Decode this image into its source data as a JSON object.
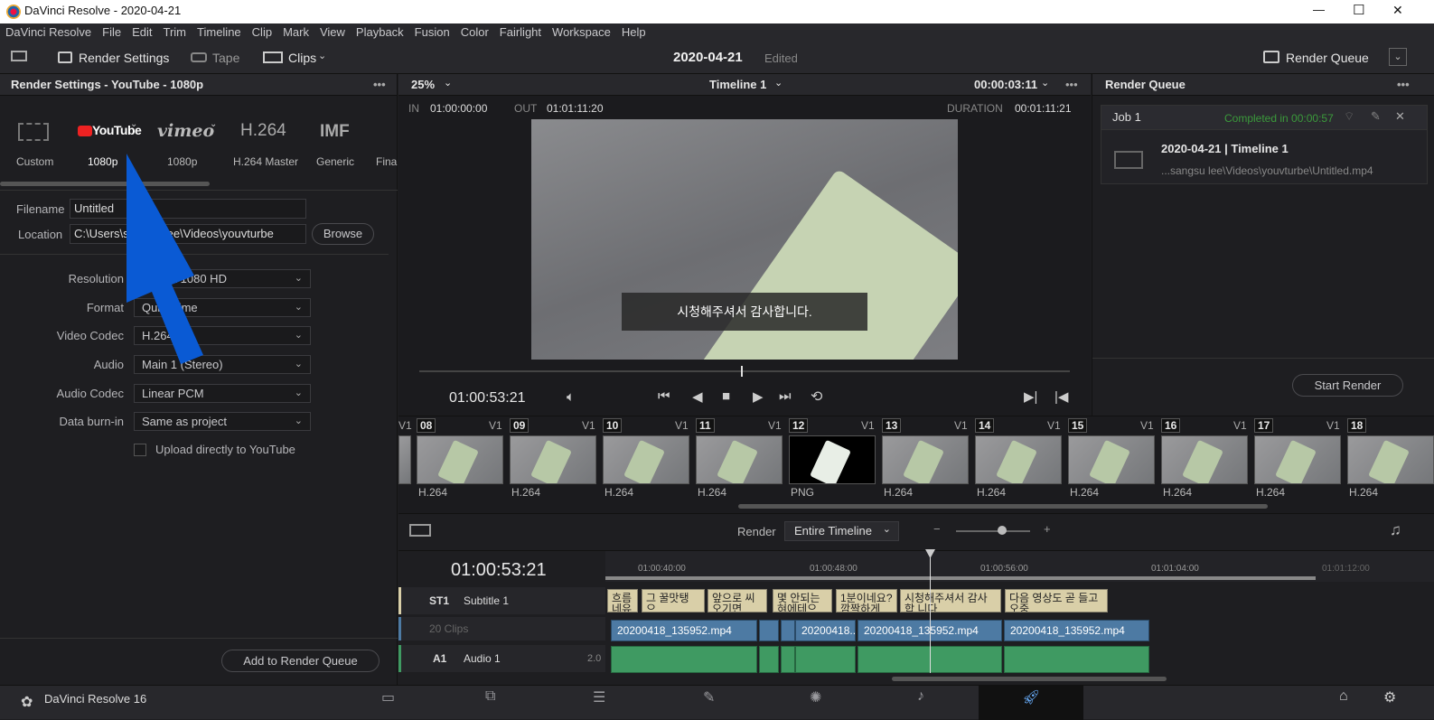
{
  "window": {
    "title": "DaVinci Resolve - 2020-04-21",
    "minimize": "—",
    "maximize": "☐",
    "close": "✕"
  },
  "menu": [
    "DaVinci Resolve",
    "File",
    "Edit",
    "Trim",
    "Timeline",
    "Clip",
    "Mark",
    "View",
    "Playback",
    "Fusion",
    "Color",
    "Fairlight",
    "Workspace",
    "Help"
  ],
  "toolbar": {
    "render_settings": "Render Settings",
    "tape": "Tape",
    "clips": "Clips",
    "project": "2020-04-21",
    "status": "Edited",
    "render_queue": "Render Queue"
  },
  "render_settings": {
    "header": "Render Settings - YouTube - 1080p",
    "presets": [
      {
        "name": "Custom",
        "logo": ""
      },
      {
        "name": "1080p",
        "logo": "YouTube"
      },
      {
        "name": "1080p",
        "logo": "vimeo"
      },
      {
        "name": "H.264 Master",
        "logo": "H.264"
      },
      {
        "name": "Generic",
        "logo": "IMF"
      },
      {
        "name": "Final",
        "logo": ""
      }
    ],
    "filename_label": "Filename",
    "filename": "Untitled",
    "location_label": "Location",
    "location": "C:\\Users\\sangsu lee\\Videos\\youvturbe",
    "browse": "Browse",
    "fields": [
      {
        "label": "Resolution",
        "value": "1920 x 1080 HD"
      },
      {
        "label": "Format",
        "value": "QuickTime"
      },
      {
        "label": "Video Codec",
        "value": "H.264"
      },
      {
        "label": "Audio",
        "value": "Main 1 (Stereo)"
      },
      {
        "label": "Audio Codec",
        "value": "Linear PCM"
      },
      {
        "label": "Data burn-in",
        "value": "Same as project"
      }
    ],
    "upload": "Upload directly to YouTube",
    "add_to_queue": "Add to Render Queue"
  },
  "viewer": {
    "zoom": "25%",
    "timeline": "Timeline 1",
    "timecode_top": "00:00:03:11",
    "in_label": "IN",
    "in": "01:00:00:00",
    "out_label": "OUT",
    "out": "01:01:11:20",
    "duration_label": "DURATION",
    "duration": "00:01:11:21",
    "subtitle": "시청해주셔서 감사합니다.",
    "timecode": "01:00:53:21"
  },
  "queue": {
    "header": "Render Queue",
    "job": "Job 1",
    "job_status": "Completed in 00:00:57",
    "job_title": "2020-04-21 | Timeline 1",
    "job_path": "...sangsu lee\\Videos\\youvturbe\\Untitled.mp4",
    "start_render": "Start Render"
  },
  "clips": [
    {
      "num": "08",
      "codec": "H.264"
    },
    {
      "num": "09",
      "codec": "H.264"
    },
    {
      "num": "10",
      "codec": "H.264"
    },
    {
      "num": "11",
      "codec": "H.264"
    },
    {
      "num": "12",
      "codec": "PNG"
    },
    {
      "num": "13",
      "codec": "H.264"
    },
    {
      "num": "14",
      "codec": "H.264"
    },
    {
      "num": "15",
      "codec": "H.264"
    },
    {
      "num": "16",
      "codec": "H.264"
    },
    {
      "num": "17",
      "codec": "H.264"
    },
    {
      "num": "18",
      "codec": "H.264"
    }
  ],
  "track_label": "V1",
  "timeline": {
    "render_label": "Render",
    "render_mode": "Entire Timeline",
    "timecode": "01:00:53:21",
    "ruler": [
      "01:00:40:00",
      "01:00:48:00",
      "01:00:56:00",
      "01:01:04:00",
      "01:01:12:00"
    ],
    "st1": "ST1",
    "subtitle_track": "Subtitle 1",
    "clips_count": "20 Clips",
    "a1": "A1",
    "audio_track": "Audio 1",
    "audio_ch": "2.0",
    "subs": [
      "흐름 네유기",
      "그 꿀맛탱 으",
      "앞으로 씨 오기면",
      "몇 안되는 혀에테으",
      "1분이네요? 깜짝하게",
      "시청해주셔서 감사합 니다",
      "다음 영상도 곧 들고 오중"
    ],
    "vclips": [
      "20200418_135952.mp4",
      "20200418...",
      "20200418_135952.mp4",
      "20200418_135952.mp4"
    ]
  },
  "bottom": {
    "app": "DaVinci Resolve 16"
  },
  "colors": {
    "accent_blue": "#0a5ad4",
    "queue_green": "#3b9a3b",
    "video_clip": "#4d7aa3",
    "audio_clip": "#3f9a62"
  }
}
